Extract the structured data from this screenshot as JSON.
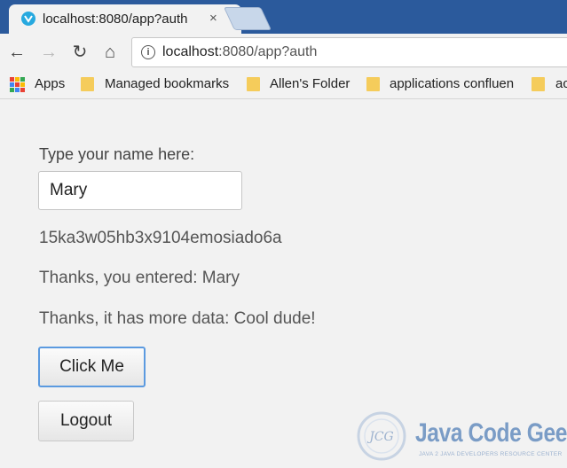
{
  "browser": {
    "tab_title": "localhost:8080/app?auth",
    "tab_close": "×",
    "url_host": "localhost",
    "url_rest": ":8080/app?auth"
  },
  "bookmarks": [
    {
      "label": "Apps",
      "icon": "apps-grid-icon"
    },
    {
      "label": "Managed bookmarks",
      "icon": "folder-icon"
    },
    {
      "label": "Allen's Folder",
      "icon": "folder-icon"
    },
    {
      "label": "applications confluen",
      "icon": "folder-icon"
    },
    {
      "label": "ac",
      "icon": "folder-icon"
    }
  ],
  "form": {
    "prompt": "Type your name here:",
    "name_value": "Mary",
    "token": "15ka3w05hb3x9104emosiado6a",
    "entered_text": "Thanks, you entered: Mary",
    "more_data_text": "Thanks, it has more data: Cool dude!",
    "click_button": "Click Me",
    "logout_button": "Logout"
  },
  "watermark": {
    "badge": "JCG",
    "title": "Java Code Geeks",
    "subtitle": "JAVA 2 JAVA DEVELOPERS RESOURCE CENTER"
  },
  "colors": {
    "tabstrip": "#2b5a9c",
    "focus_ring": "#5b9ae0",
    "folder": "#f5cc5b"
  }
}
